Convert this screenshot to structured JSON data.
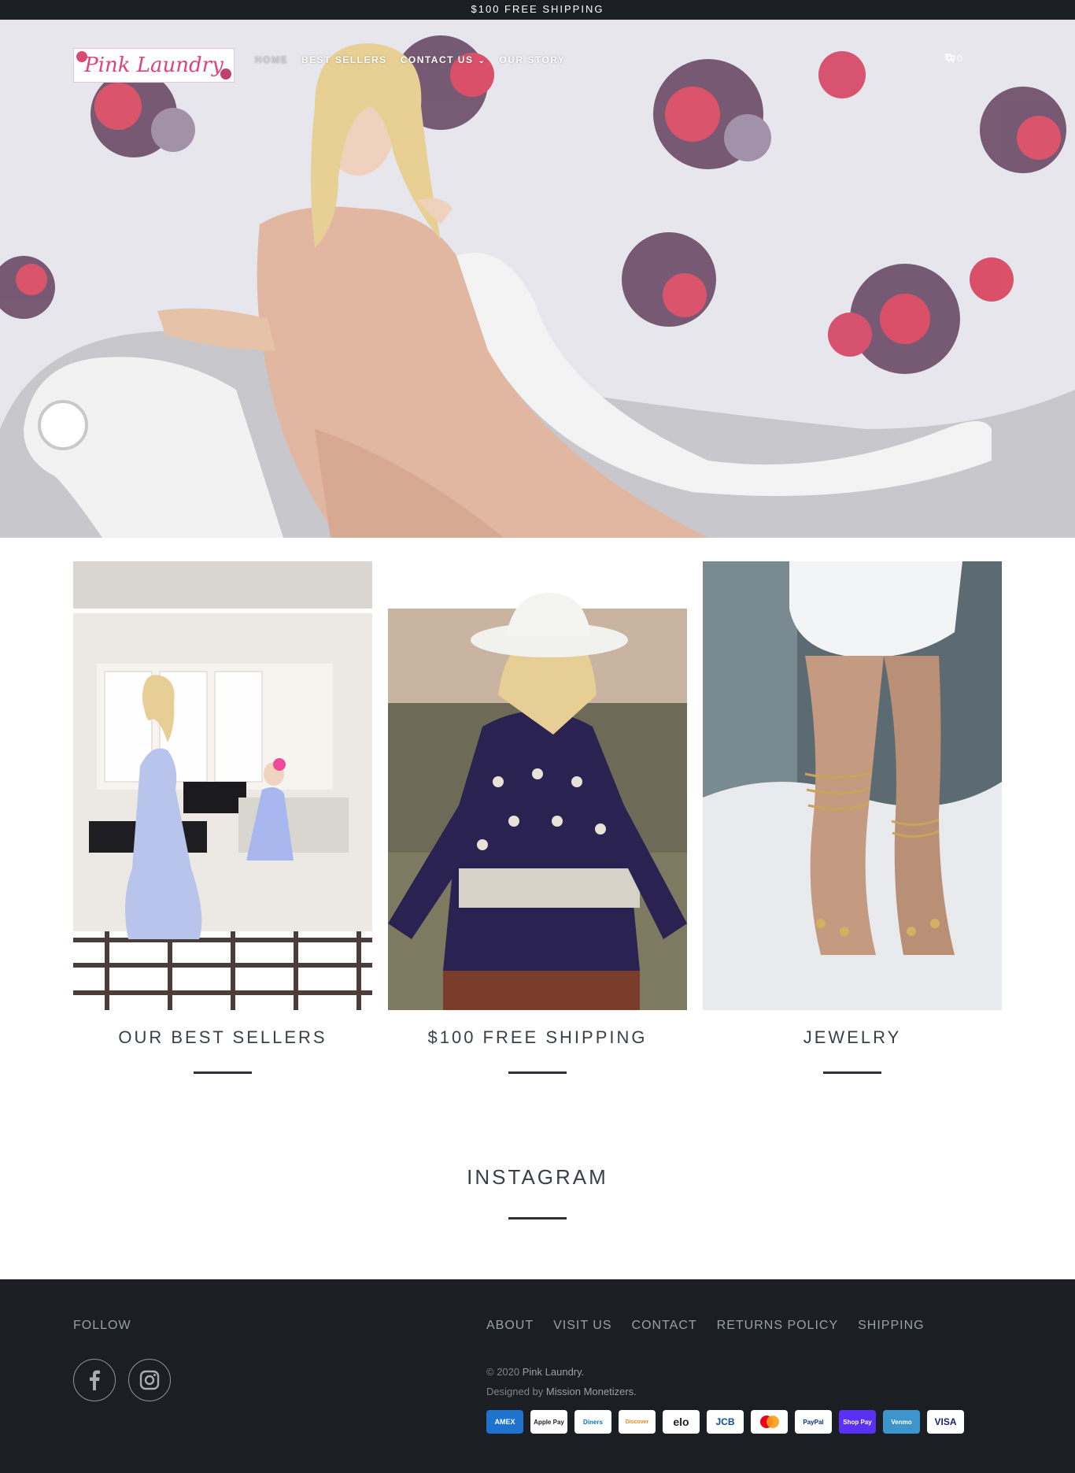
{
  "announcement": "$100 FREE SHIPPING",
  "logo_text": "Pink Laundry",
  "nav": {
    "items": [
      "HOME",
      "BEST SELLERS",
      "CONTACT US",
      "OUR STORY"
    ],
    "cart_count": "0"
  },
  "icons": {
    "search": "search-icon",
    "cart": "cart-icon",
    "dropdown": "chevron-down-icon",
    "facebook": "facebook-icon",
    "instagram": "instagram-icon"
  },
  "collections": [
    {
      "title": "OUR BEST SELLERS"
    },
    {
      "title": "$100 FREE SHIPPING"
    },
    {
      "title": "JEWELRY"
    }
  ],
  "instagram_title": "INSTAGRAM",
  "footer": {
    "follow_label": "FOLLOW",
    "links": [
      "ABOUT",
      "VISIT US",
      "CONTACT",
      "RETURNS POLICY",
      "SHIPPING"
    ],
    "copyright_prefix": "© 2020",
    "copyright_name": "Pink Laundry.",
    "designed_prefix": "Designed by",
    "designed_name": "Mission Monetizers.",
    "payment_methods": [
      "AMEX",
      "Apple Pay",
      "Diners",
      "Discover",
      "elo",
      "JCB",
      "Mastercard",
      "PayPal",
      "Shop Pay",
      "Venmo",
      "VISA"
    ]
  },
  "colors": {
    "dark": "#1b1f24",
    "brand_pink": "#e0427a",
    "footer_text": "#9aa0a8"
  }
}
